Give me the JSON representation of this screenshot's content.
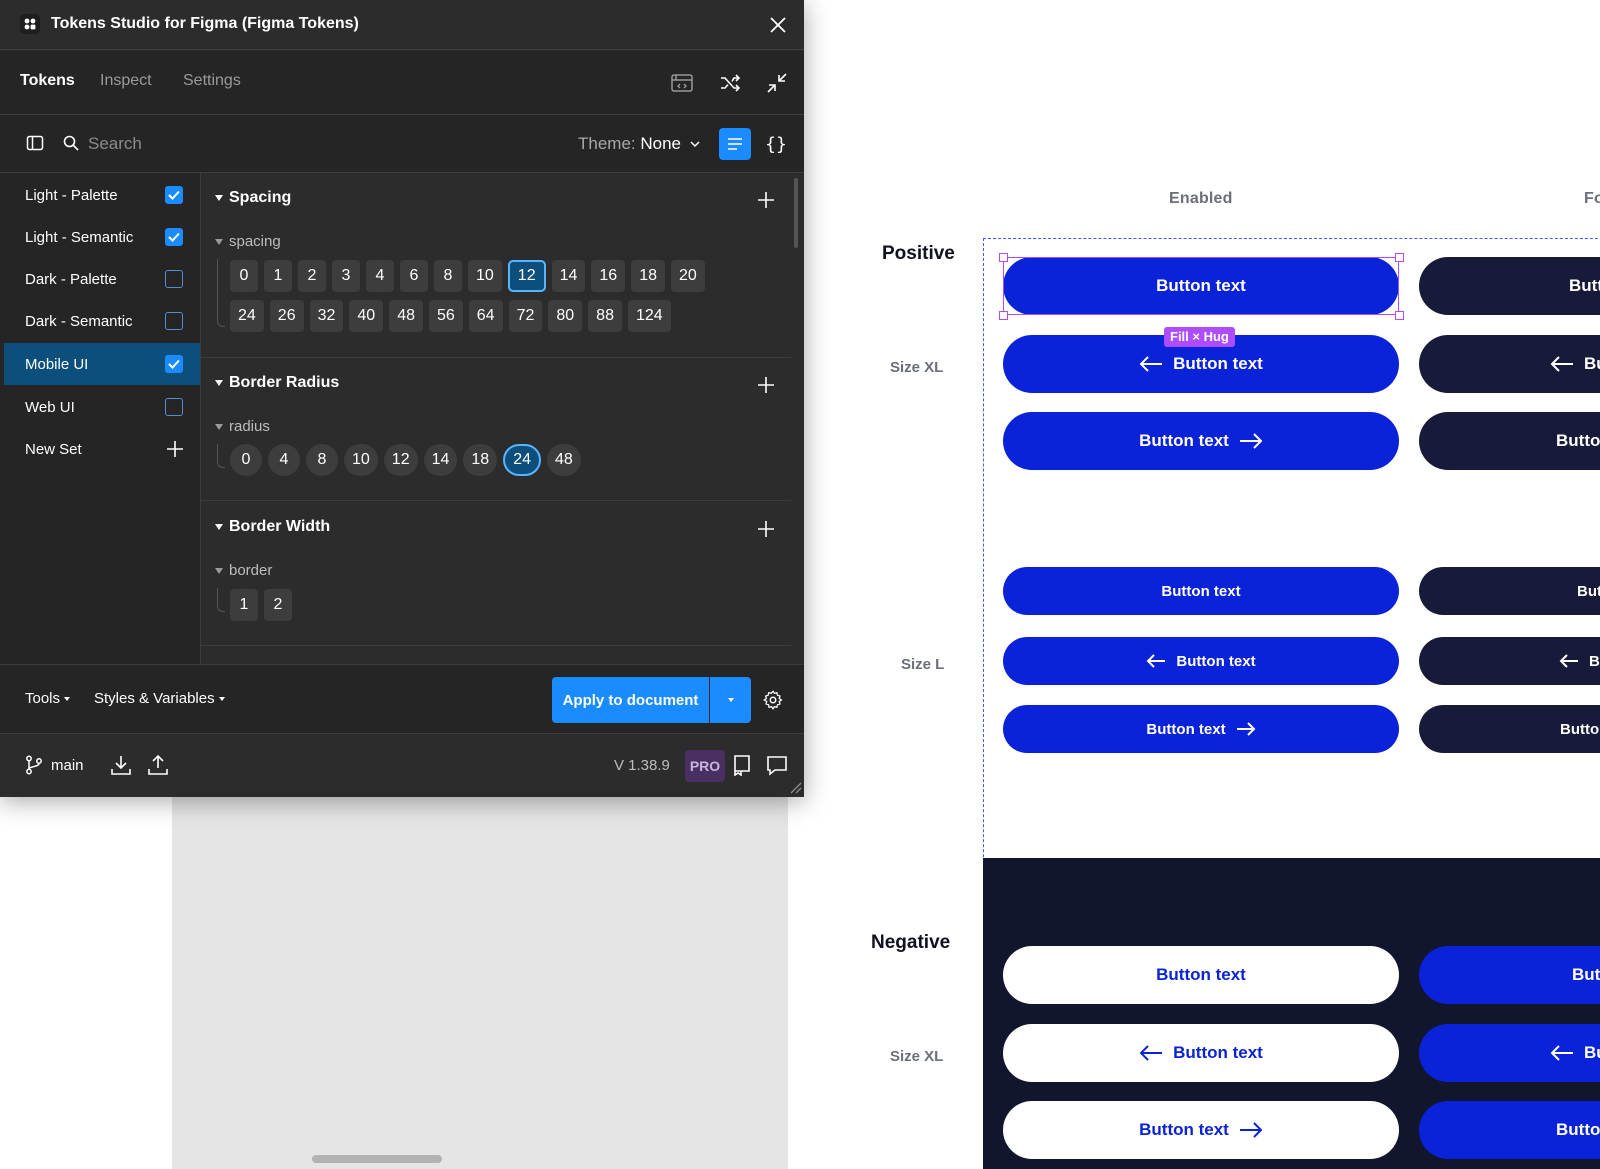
{
  "plugin": {
    "title": "Tokens Studio for Figma (Figma Tokens)",
    "tabs": [
      {
        "label": "Tokens",
        "active": true
      },
      {
        "label": "Inspect",
        "active": false
      },
      {
        "label": "Settings",
        "active": false
      }
    ],
    "toolbar_icons": [
      "preview-icon",
      "shuffle-icon",
      "minimize-icon"
    ],
    "search": {
      "placeholder": "Search"
    },
    "theme": {
      "label": "Theme:",
      "value": "None"
    },
    "view_icons": [
      "list-view-icon",
      "json-view-icon"
    ]
  },
  "sets": [
    {
      "label": "Light - Palette",
      "checked": true,
      "active": false
    },
    {
      "label": "Light - Semantic",
      "checked": true,
      "active": false
    },
    {
      "label": "Dark - Palette",
      "checked": false,
      "active": false
    },
    {
      "label": "Dark - Semantic",
      "checked": false,
      "active": false
    },
    {
      "label": "Mobile UI",
      "checked": true,
      "active": true
    },
    {
      "label": "Web UI",
      "checked": false,
      "active": false
    }
  ],
  "new_set_label": "New Set",
  "groups": {
    "spacing": {
      "title": "Spacing",
      "sub": "spacing",
      "row1": [
        "0",
        "1",
        "2",
        "3",
        "4",
        "6",
        "8",
        "10",
        "12",
        "14",
        "16",
        "18",
        "20"
      ],
      "row2": [
        "24",
        "26",
        "32",
        "40",
        "48",
        "56",
        "64",
        "72",
        "80",
        "88",
        "124"
      ],
      "selected": "12"
    },
    "radius": {
      "title": "Border Radius",
      "sub": "radius",
      "values": [
        "0",
        "4",
        "8",
        "10",
        "12",
        "14",
        "18",
        "24",
        "48"
      ],
      "selected": "24"
    },
    "border": {
      "title": "Border Width",
      "sub": "border",
      "values": [
        "1",
        "2"
      ]
    }
  },
  "footer": {
    "tools_label": "Tools",
    "styles_label": "Styles & Variables",
    "apply_label": "Apply to document"
  },
  "status": {
    "branch": "main",
    "version": "V 1.38.9",
    "pro": "PRO"
  },
  "canvas": {
    "columns": [
      "Enabled",
      "Fo"
    ],
    "positive_title": "Positive",
    "negative_title": "Negative",
    "size_xl": "Size XL",
    "size_l": "Size L",
    "button_text": "Button text",
    "fill_hug": "Fill × Hug",
    "clipped": {
      "plain": "Butt",
      "left": "Bu",
      "right": "Butto",
      "l_plain": "But",
      "l_left": "Bu",
      "l_right": "Butto"
    }
  },
  "colors": {
    "accent": "#1a8cff",
    "brand_blue": "#0a23d8",
    "dark_navy": "#171a38",
    "negative_bg": "#12152e",
    "selection": "#b04cff",
    "plugin_bg": "#2c2c2c"
  }
}
